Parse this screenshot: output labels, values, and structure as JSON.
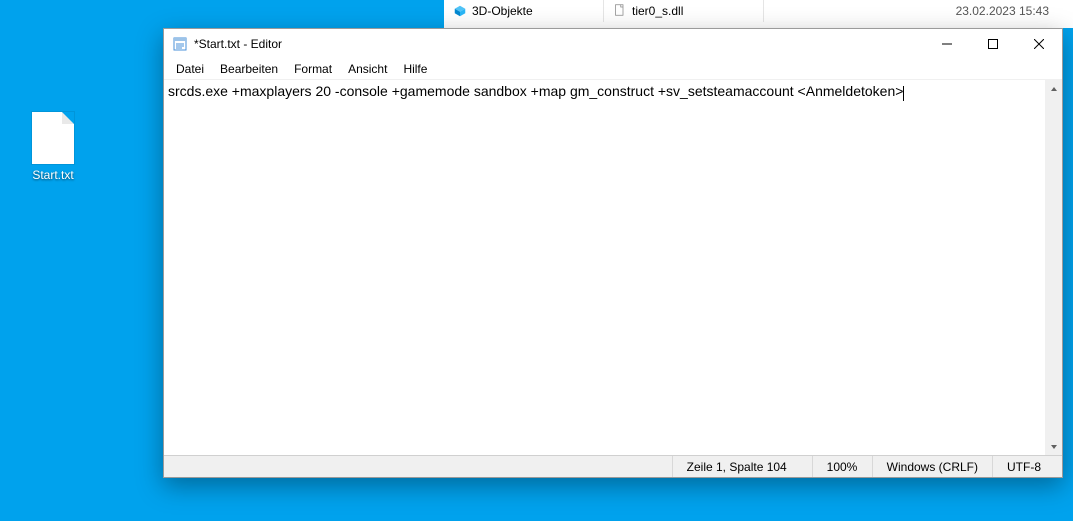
{
  "desktop": {
    "icon_label": "Start.txt"
  },
  "background_explorer": {
    "tab1": "3D-Objekte",
    "tab2": "tier0_s.dll",
    "timestamp": "23.02.2023 15:43"
  },
  "notepad": {
    "title": "*Start.txt - Editor",
    "menu": {
      "file": "Datei",
      "edit": "Bearbeiten",
      "format": "Format",
      "view": "Ansicht",
      "help": "Hilfe"
    },
    "content": "srcds.exe +maxplayers 20 -console +gamemode sandbox +map gm_construct +sv_setsteamaccount <Anmeldetoken>",
    "status": {
      "position": "Zeile 1, Spalte 104",
      "zoom": "100%",
      "line_ending": "Windows (CRLF)",
      "encoding": "UTF-8"
    }
  }
}
